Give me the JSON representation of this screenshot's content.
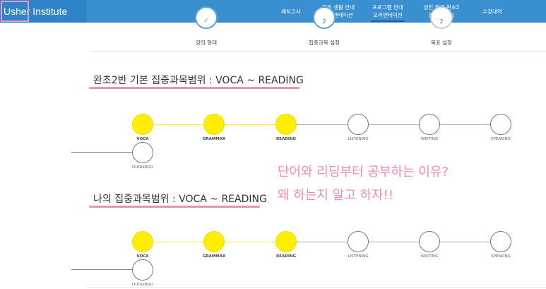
{
  "header": {
    "brand": "Usher Institute",
    "nav": [
      {
        "label": "배치고사"
      },
      {
        "label": "학원 생활 안내\n오리엔테이션"
      },
      {
        "label": "프로그램 안내\n오리엔테이션"
      },
      {
        "label": "성인 정규 완초2\n참강 강의실"
      },
      {
        "label": "수강내역"
      }
    ]
  },
  "steps": [
    {
      "number": "",
      "label": "강의 형태"
    },
    {
      "number": "2",
      "label": "집중과목 설정"
    },
    {
      "number": "2",
      "label": "목표 설정"
    }
  ],
  "sections": [
    {
      "title": "완초2반 기본 집중과목범위 : VOCA ~ READING"
    },
    {
      "title": "나의 집중과목범위 : VOCA ~ READING"
    }
  ],
  "annotation": {
    "line1": "단어와 리딩부터 공부하는 이유?",
    "line2": "왜 하는지 알고 하자!!"
  },
  "subjects": [
    "VOCA",
    "GRAMMAR",
    "READING",
    "LISTENING",
    "WRITING",
    "SPEAKING",
    "DUOLINGO"
  ],
  "colors": {
    "nav_bg": "#3a8fd0",
    "highlight_yellow": "#ffee00",
    "annotation_pink": "#f08ab8"
  },
  "icons": {
    "step_done": "check-icon"
  }
}
